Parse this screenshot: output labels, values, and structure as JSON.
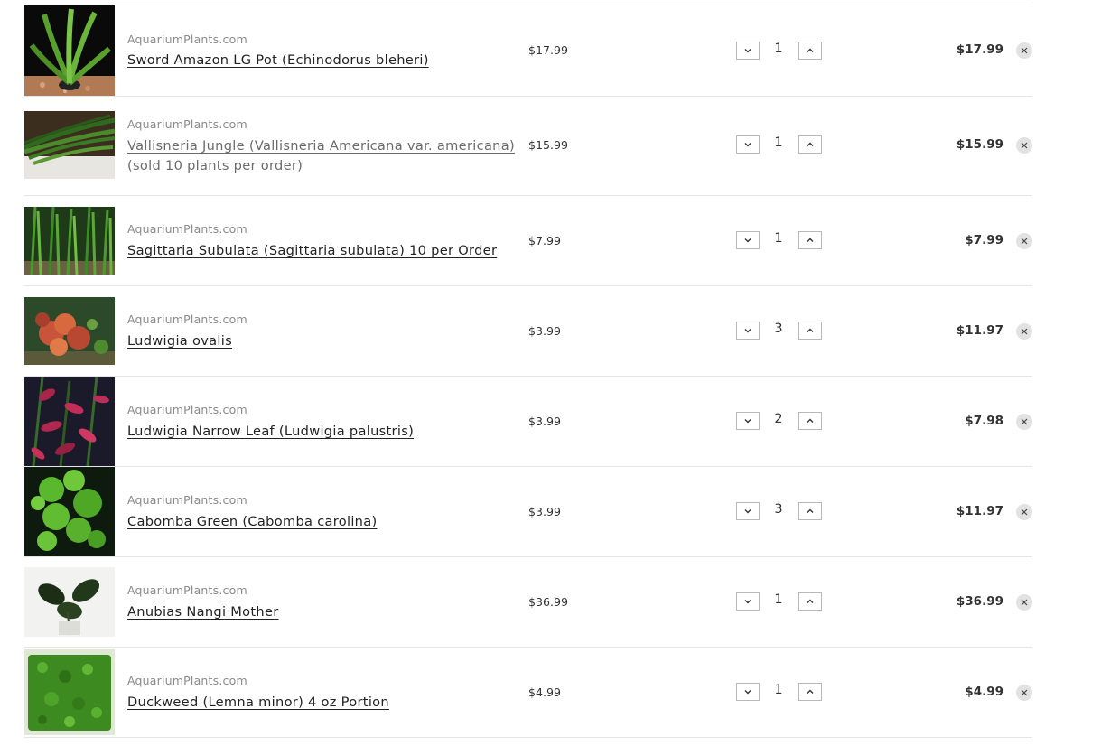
{
  "cart": {
    "items": [
      {
        "vendor": "AquariumPlants.com",
        "title": "Sword Amazon LG Pot (Echinodorus bleheri)",
        "unit_price": "$17.99",
        "quantity": "1",
        "total": "$17.99"
      },
      {
        "vendor": "AquariumPlants.com",
        "title": "Vallisneria Jungle (Vallisneria Americana var. americana)(sold 10 plants per order)",
        "unit_price": "$15.99",
        "quantity": "1",
        "total": "$15.99"
      },
      {
        "vendor": "AquariumPlants.com",
        "title": "Sagittaria Subulata (Sagittaria subulata) 10 per Order",
        "unit_price": "$7.99",
        "quantity": "1",
        "total": "$7.99"
      },
      {
        "vendor": "AquariumPlants.com",
        "title": "Ludwigia ovalis",
        "unit_price": "$3.99",
        "quantity": "3",
        "total": "$11.97"
      },
      {
        "vendor": "AquariumPlants.com",
        "title": "Ludwigia Narrow Leaf (Ludwigia palustris)",
        "unit_price": "$3.99",
        "quantity": "2",
        "total": "$7.98"
      },
      {
        "vendor": "AquariumPlants.com",
        "title": "Cabomba Green (Cabomba carolina)",
        "unit_price": "$3.99",
        "quantity": "3",
        "total": "$11.97"
      },
      {
        "vendor": "AquariumPlants.com",
        "title": "Anubias Nangi Mother",
        "unit_price": "$36.99",
        "quantity": "1",
        "total": "$36.99"
      },
      {
        "vendor": "AquariumPlants.com",
        "title": "Duckweed (Lemna minor) 4 oz Portion",
        "unit_price": "$4.99",
        "quantity": "1",
        "total": "$4.99"
      }
    ]
  },
  "icons": {
    "decrease": "chevron-down-icon",
    "increase": "chevron-up-icon",
    "remove": "close-icon"
  },
  "colors": {
    "divider": "#e6e6e6",
    "vendor_text": "#8a8a8a",
    "remove_bg": "#e2e2e2"
  }
}
